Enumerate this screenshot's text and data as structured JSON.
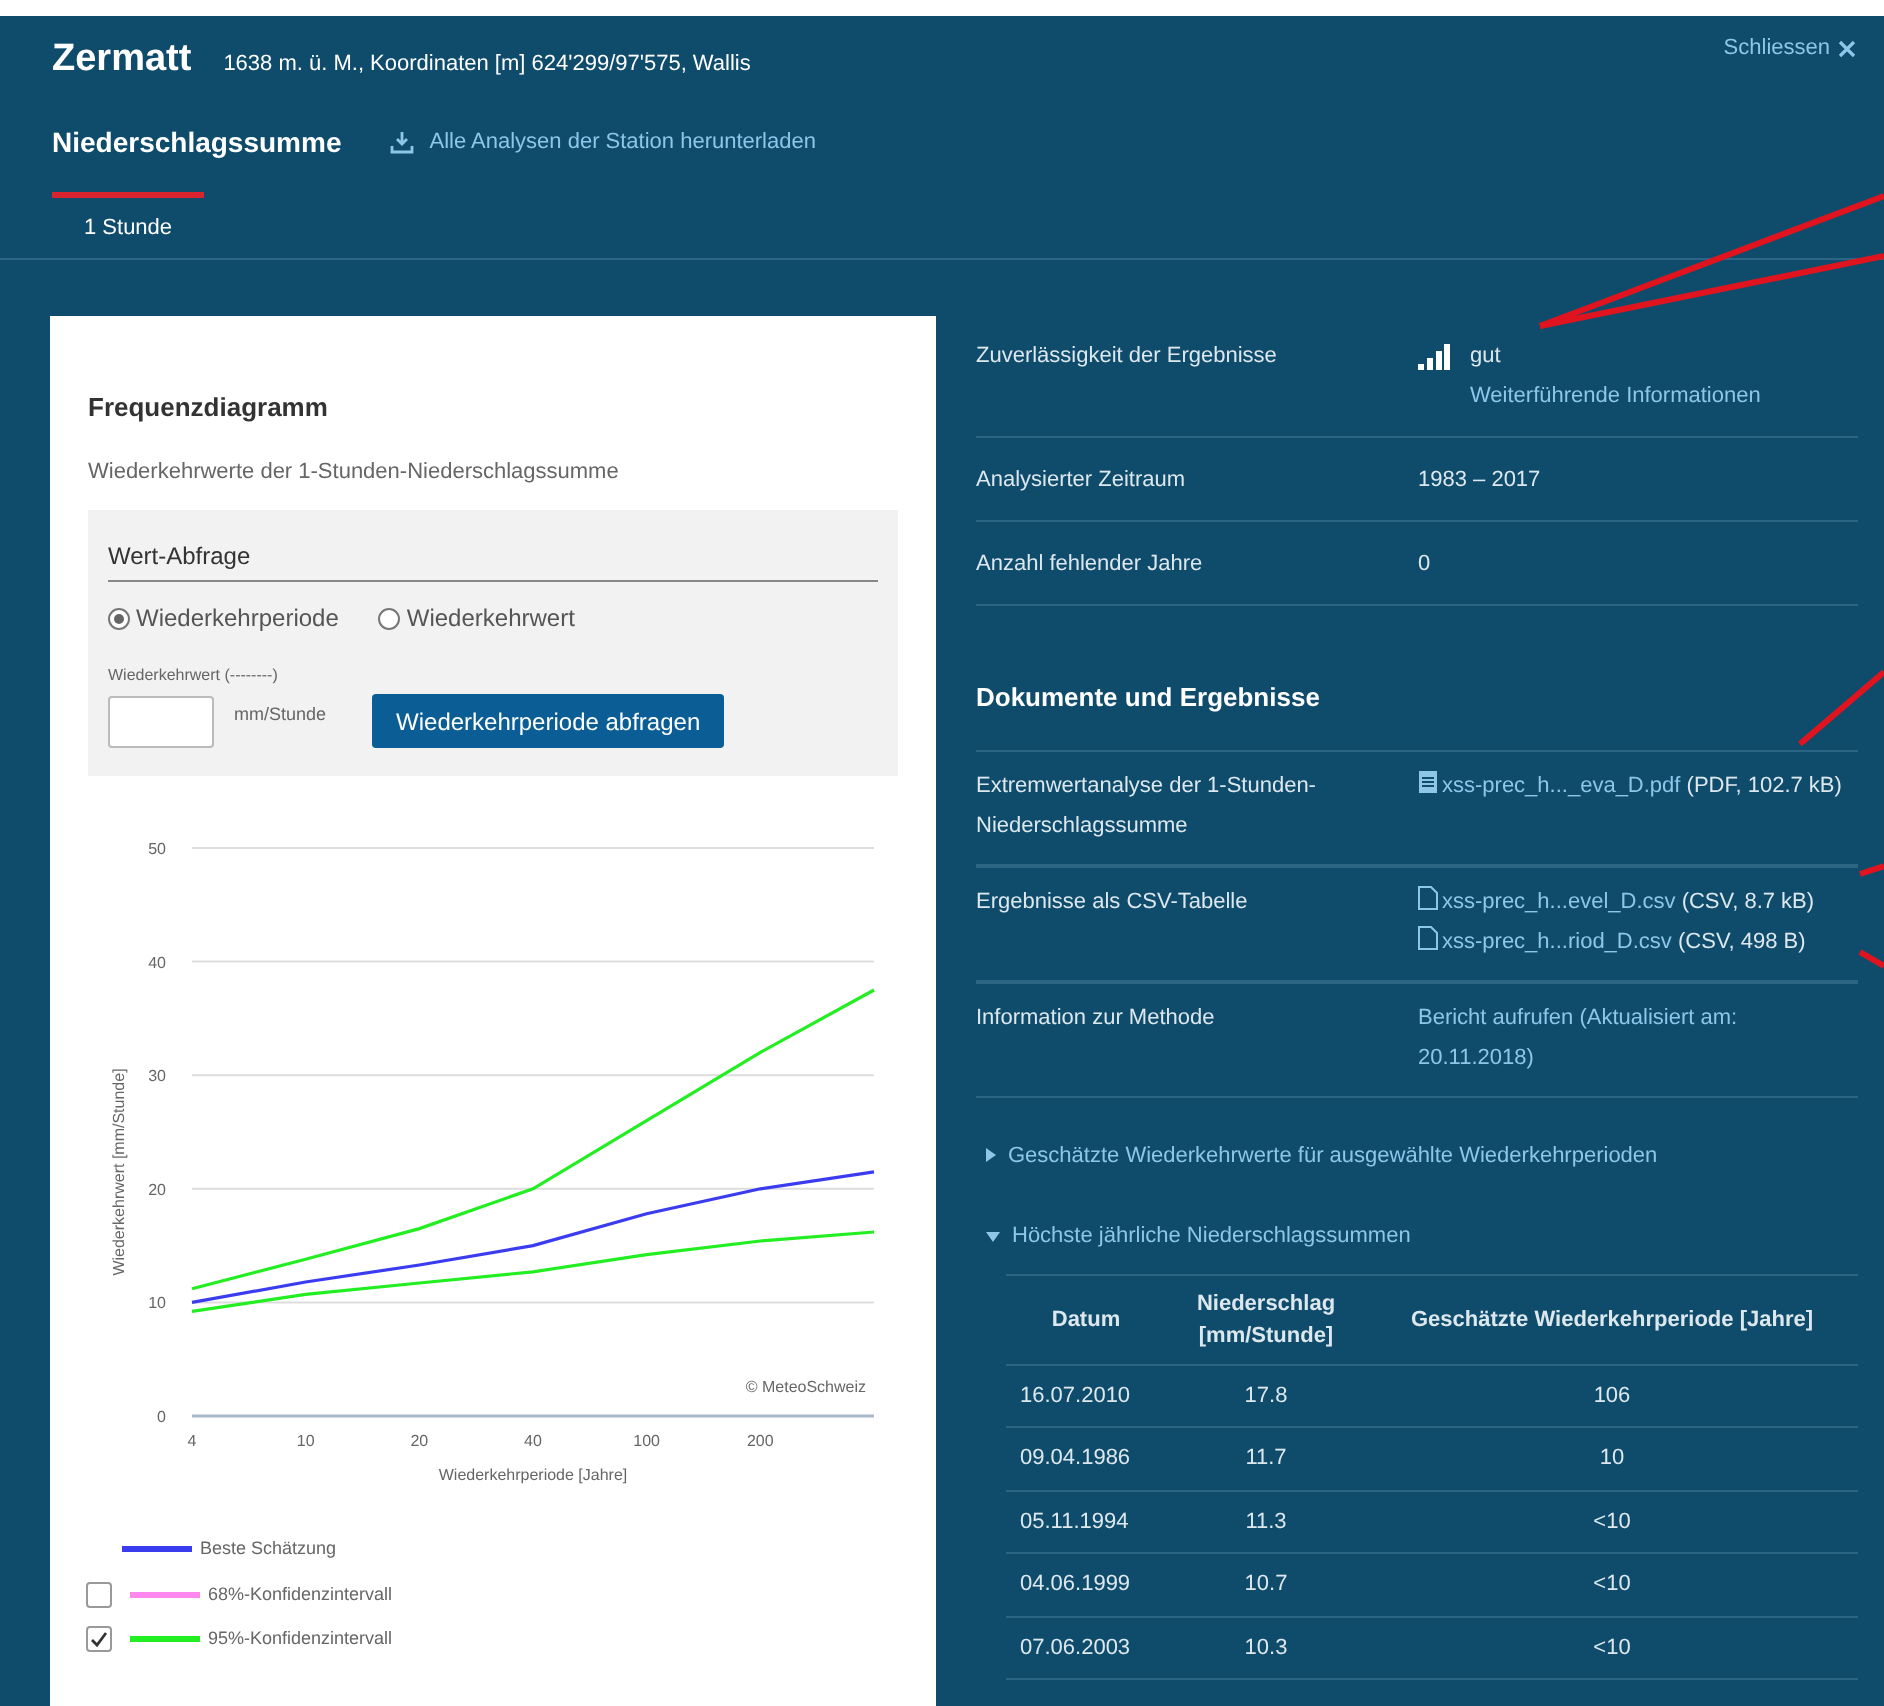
{
  "header": {
    "title": "Zermatt",
    "subtitle": "1638 m. ü. M., Koordinaten [m] 624'299/97'575, Wallis",
    "close": "Schliessen"
  },
  "subheader": {
    "title": "Niederschlagssumme",
    "download_link": "Alle Analysen der Station herunterladen"
  },
  "tabs": [
    {
      "label": "1 Stunde",
      "selected": true
    }
  ],
  "chart_card": {
    "title": "Frequenzdiagramm",
    "subtitle": "Wiederkehrwerte der 1-Stunden-Niederschlagssumme",
    "query": {
      "title": "Wert-Abfrage",
      "options": [
        {
          "label": "Wiederkehrperiode",
          "selected": true
        },
        {
          "label": "Wiederkehrwert",
          "selected": false
        }
      ],
      "field_label": "Wiederkehrwert (--------)",
      "unit": "mm/Stunde",
      "button": "Wiederkehrperiode abfragen"
    },
    "chart_data": {
      "type": "line",
      "xlabel": "Wiederkehrperiode [Jahre]",
      "ylabel": "Wiederkehrwert [mm/Stunde]",
      "categories": [
        "4",
        "10",
        "20",
        "40",
        "100",
        "200",
        null
      ],
      "ylim": [
        0,
        50
      ],
      "grid": true,
      "yticks": [
        0,
        10,
        20,
        30,
        40,
        50
      ],
      "annotations": [
        "© MeteoSchweiz"
      ],
      "series": [
        {
          "name": "Beste Schätzung",
          "color": "#3b3bf0",
          "values": [
            10,
            11.8,
            13.3,
            15,
            17.8,
            20,
            21.5
          ]
        },
        {
          "color": "#22ee22",
          "values": [
            11.2,
            13.8,
            16.5,
            20,
            26,
            32,
            37.5
          ]
        },
        {
          "color": "#22ee22",
          "values": [
            9.2,
            10.7,
            11.7,
            12.7,
            14.2,
            15.4,
            16.2
          ]
        }
      ]
    },
    "legend": {
      "toggles": [
        {
          "label": "68%-Konfidenzintervall",
          "color": "#ff88ee",
          "checked": false
        },
        {
          "label": "95%-Konfidenzintervall",
          "color": "#22ee22",
          "checked": true
        }
      ]
    }
  },
  "info_rows": [
    {
      "kind": "rating",
      "label": "Zuverlässigkeit der Ergebnisse",
      "value": "gut",
      "link": "Weiterführende Informationen"
    },
    {
      "kind": "text",
      "label": "Analysierter Zeitraum",
      "value": "1983 – 2017"
    },
    {
      "kind": "text",
      "label": "Anzahl fehlender Jahre",
      "value": "0"
    }
  ],
  "documents": {
    "title": "Dokumente und Ergebnisse",
    "rows": [
      {
        "kind": "files",
        "label": "Extremwertanalyse der 1-Stunden-Niederschlagssumme",
        "files": [
          {
            "kind": "pdf",
            "name": "xss-prec_h..._eva_D.pdf",
            "size": "(PDF, 102.7 kB)"
          }
        ]
      },
      {
        "kind": "files",
        "label": "Ergebnisse als CSV-Tabelle",
        "files": [
          {
            "kind": "csv",
            "name": "xss-prec_h...evel_D.csv",
            "size": "(CSV, 8.7 kB)"
          },
          {
            "kind": "csv",
            "name": "xss-prec_h...riod_D.csv",
            "size": "(CSV, 498 B)"
          }
        ]
      },
      {
        "kind": "link",
        "label": "Information zur Methode",
        "value": "Bericht aufrufen (Aktualisiert am: 20.11.2018)"
      }
    ]
  },
  "sections": [
    {
      "label": "Geschätzte Wiederkehrwerte für ausgewählte Wiederkehrperioden",
      "expanded": false
    },
    {
      "label": "Höchste jährliche Niederschlagssummen",
      "expanded": true,
      "table": {
        "columns": [
          "Datum",
          "Niederschlag [mm/Stunde]",
          "Geschätzte Wiederkehrperiode [Jahre]"
        ],
        "rows": [
          [
            "16.07.2010",
            "17.8",
            "106"
          ],
          [
            "09.04.1986",
            "11.7",
            "10"
          ],
          [
            "05.11.1994",
            "11.3",
            "<10"
          ],
          [
            "04.06.1999",
            "10.7",
            "<10"
          ],
          [
            "07.06.2003",
            "10.3",
            "<10"
          ]
        ]
      }
    }
  ]
}
